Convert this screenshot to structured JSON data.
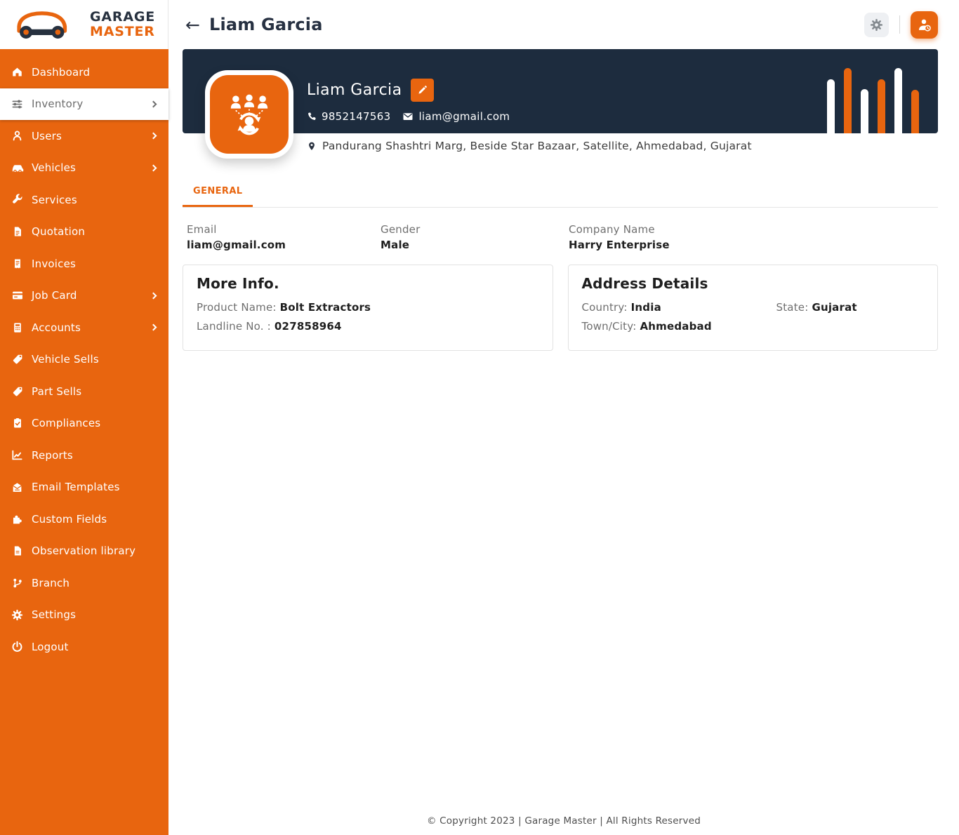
{
  "colors": {
    "accent": "#E8650F",
    "navy": "#1D2C3E"
  },
  "brand": {
    "line1": "GARAGE",
    "line2": "MASTER",
    "icon": "car-wrench-logo"
  },
  "topbar": {
    "back_icon": "←",
    "title": "Liam Garcia",
    "buttons": [
      {
        "icon": "gear-icon"
      },
      {
        "icon": "user-log-icon"
      }
    ]
  },
  "sidebar": {
    "items": [
      {
        "label": "Dashboard",
        "icon": "home-icon",
        "active": false,
        "has_submenu": false
      },
      {
        "label": "Inventory",
        "icon": "sliders-icon",
        "active": true,
        "has_submenu": true
      },
      {
        "label": "Users",
        "icon": "user-icon",
        "active": false,
        "has_submenu": true
      },
      {
        "label": "Vehicles",
        "icon": "car-icon",
        "active": false,
        "has_submenu": true
      },
      {
        "label": "Services",
        "icon": "wrench-icon",
        "active": false,
        "has_submenu": false
      },
      {
        "label": "Quotation",
        "icon": "document-icon",
        "active": false,
        "has_submenu": false
      },
      {
        "label": "Invoices",
        "icon": "receipt-icon",
        "active": false,
        "has_submenu": false
      },
      {
        "label": "Job Card",
        "icon": "id-card-icon",
        "active": false,
        "has_submenu": true
      },
      {
        "label": "Accounts",
        "icon": "calculator-icon",
        "active": false,
        "has_submenu": true
      },
      {
        "label": "Vehicle Sells",
        "icon": "tag-icon",
        "active": false,
        "has_submenu": false
      },
      {
        "label": "Part Sells",
        "icon": "tag-icon",
        "active": false,
        "has_submenu": false
      },
      {
        "label": "Compliances",
        "icon": "clipboard-check-icon",
        "active": false,
        "has_submenu": false
      },
      {
        "label": "Reports",
        "icon": "chart-line-icon",
        "active": false,
        "has_submenu": false
      },
      {
        "label": "Email Templates",
        "icon": "envelope-open-icon",
        "active": false,
        "has_submenu": false
      },
      {
        "label": "Custom Fields",
        "icon": "puzzle-icon",
        "active": false,
        "has_submenu": false
      },
      {
        "label": "Observation library",
        "icon": "file-icon",
        "active": false,
        "has_submenu": false
      },
      {
        "label": "Branch",
        "icon": "code-branch-icon",
        "active": false,
        "has_submenu": false
      },
      {
        "label": "Settings",
        "icon": "gear-icon",
        "active": false,
        "has_submenu": false
      },
      {
        "label": "Logout",
        "icon": "power-icon",
        "active": false,
        "has_submenu": false
      }
    ]
  },
  "profile": {
    "name": "Liam Garcia",
    "phone": "9852147563",
    "email": "liam@gmail.com",
    "address": "Pandurang Shashtri Marg, Beside Star Bazaar, Satellite, Ahmedabad, Gujarat",
    "avatar_icon": "customer-group-sync-icon"
  },
  "tabs": {
    "general": "GENERAL"
  },
  "details": {
    "fields": [
      {
        "label": "Email",
        "value": "liam@gmail.com"
      },
      {
        "label": "Gender",
        "value": "Male"
      },
      {
        "label": "Company Name",
        "value": "Harry Enterprise"
      }
    ]
  },
  "more_info": {
    "title": "More Info.",
    "rows": [
      {
        "label": "Product Name:",
        "value": "Bolt Extractors"
      },
      {
        "label": "Landline No. :",
        "value": "027858964"
      }
    ]
  },
  "address_details": {
    "title": "Address Details",
    "rows": [
      {
        "label": "Country:",
        "value": "India"
      },
      {
        "label": "State:",
        "value": "Gujarat"
      },
      {
        "label": "Town/City:",
        "value": "Ahmedabad"
      }
    ]
  },
  "footer": {
    "text": "© Copyright 2023 | Garage Master | All Rights Reserved"
  }
}
